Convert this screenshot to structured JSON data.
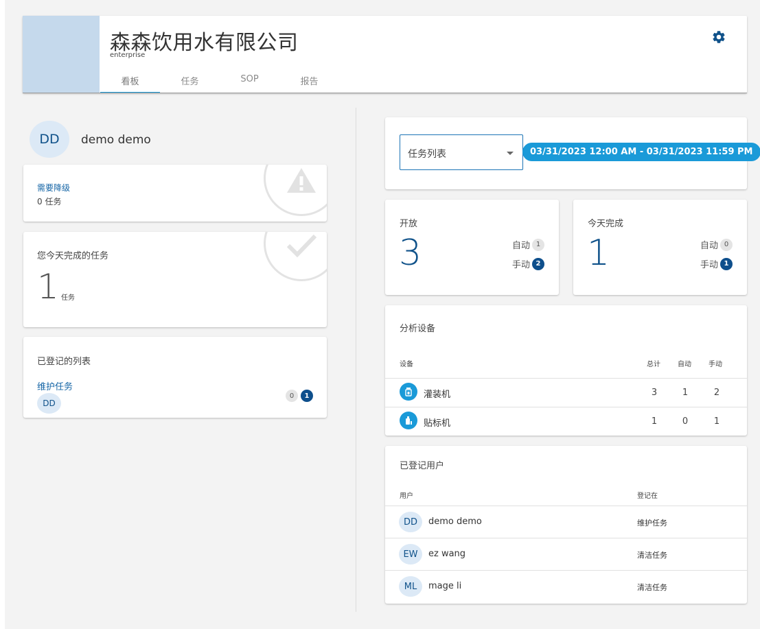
{
  "header": {
    "company_name": "森森饮用水有限公司",
    "company_type": "enterprise",
    "tabs": [
      {
        "label": "看板"
      },
      {
        "label": "任务"
      },
      {
        "label": "SOP"
      },
      {
        "label": "报告"
      }
    ],
    "active_tab": "看板",
    "settings_icon": "gear-icon"
  },
  "user": {
    "initials": "DD",
    "name": "demo demo"
  },
  "downgrade": {
    "title": "需要降级",
    "count_text": "0 任务",
    "icon": "warning-icon"
  },
  "today": {
    "title": "您今天完成的任务",
    "value": "1",
    "unit": "任务",
    "icon": "check-icon"
  },
  "registered_lists": {
    "title": "已登记的列表",
    "items": [
      {
        "name": "维护任务",
        "avatar": "DD",
        "auto_count": "0",
        "manual_count": "1"
      }
    ]
  },
  "filter": {
    "select_value": "任务列表",
    "date_range": "03/31/2023 12:00 AM - 03/31/2023 11:59 PM"
  },
  "open_stats": {
    "title": "开放",
    "value": "3",
    "auto_label": "自动",
    "auto_count": "1",
    "manual_label": "手动",
    "manual_count": "2"
  },
  "done_stats": {
    "title": "今天完成",
    "value": "1",
    "auto_label": "自动",
    "auto_count": "0",
    "manual_label": "手动",
    "manual_count": "1"
  },
  "devices": {
    "title": "分析设备",
    "headers": {
      "device": "设备",
      "total": "总计",
      "auto": "自动",
      "manual": "手动"
    },
    "rows": [
      {
        "name": "灌装机",
        "icon": "filling-machine-icon",
        "total": "3",
        "auto": "1",
        "manual": "2"
      },
      {
        "name": "贴标机",
        "icon": "labeling-machine-icon",
        "total": "1",
        "auto": "0",
        "manual": "1"
      }
    ]
  },
  "users": {
    "title": "已登记用户",
    "headers": {
      "user": "用户",
      "registered_in": "登记在"
    },
    "rows": [
      {
        "initials": "DD",
        "name": "demo demo",
        "registered_in": "维护任务"
      },
      {
        "initials": "EW",
        "name": "ez wang",
        "registered_in": "清洁任务"
      },
      {
        "initials": "ML",
        "name": "mage li",
        "registered_in": "清洁任务"
      }
    ]
  },
  "colors": {
    "accent": "#1a9ad8",
    "primary": "#10528a",
    "logo_bg": "#c5d9ec"
  }
}
